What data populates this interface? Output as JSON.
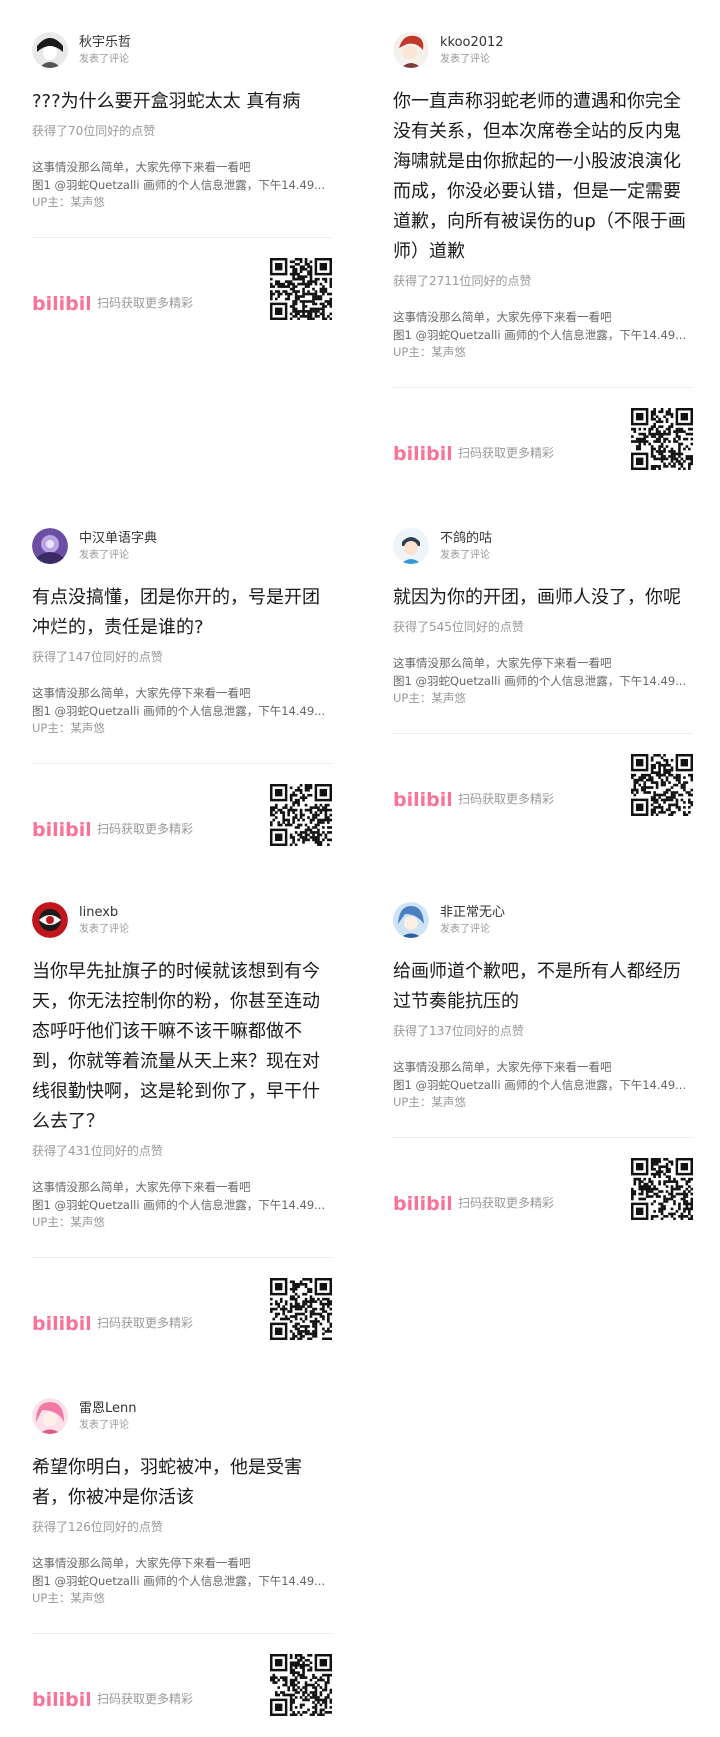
{
  "video": {
    "line1": "这事情没那么简单，大家先停下来看一看吧",
    "line2": "图1 @羽蛇Quetzalli 画师的个人信息泄露，下午14.49...",
    "uploader": "UP主：某声悠"
  },
  "footer": {
    "scan_text": "扫码获取更多精彩",
    "logo_text": "bilibili"
  },
  "colors": {
    "brand": "#fb7299",
    "muted": "#999999"
  },
  "cards": [
    {
      "username": "秋宇乐哲",
      "action": "发表了评论",
      "comment": "???为什么要开盒羽蛇太太 真有病",
      "likes": "获得了70位同好的点赞",
      "avatar_icon": "avatar-icon"
    },
    {
      "username": "kkoo2012",
      "action": "发表了评论",
      "comment": "你一直声称羽蛇老师的遭遇和你完全没有关系，但本次席卷全站的反内鬼海啸就是由你掀起的一小股波浪演化而成，你没必要认错，但是一定需要道歉，向所有被误伤的up（不限于画师）道歉",
      "likes": "获得了2711位同好的点赞",
      "avatar_icon": "avatar-icon"
    },
    {
      "username": "中汉单语字典",
      "action": "发表了评论",
      "comment": "有点没搞懂，团是你开的，号是开团冲烂的，责任是谁的?",
      "likes": "获得了147位同好的点赞",
      "avatar_icon": "avatar-icon"
    },
    {
      "username": "不鸽的咕",
      "action": "发表了评论",
      "comment": "就因为你的开团，画师人没了，你呢",
      "likes": "获得了545位同好的点赞",
      "avatar_icon": "avatar-icon"
    },
    {
      "username": "linexb",
      "action": "发表了评论",
      "comment": "当你早先扯旗子的时候就该想到有今天，你无法控制你的粉，你甚至连动态呼吁他们该干嘛不该干嘛都做不到，你就等着流量从天上来？现在对线很勤快啊，这是轮到你了，早干什么去了？",
      "likes": "获得了431位同好的点赞",
      "avatar_icon": "avatar-icon"
    },
    {
      "username": "非正常无心",
      "action": "发表了评论",
      "comment": "给画师道个歉吧，不是所有人都经历过节奏能抗压的",
      "likes": "获得了137位同好的点赞",
      "avatar_icon": "avatar-icon"
    },
    {
      "username": "雷恩Lenn",
      "action": "发表了评论",
      "comment": "希望你明白，羽蛇被冲，他是受害者，你被冲是你活该",
      "likes": "获得了126位同好的点赞",
      "avatar_icon": "avatar-icon"
    }
  ]
}
